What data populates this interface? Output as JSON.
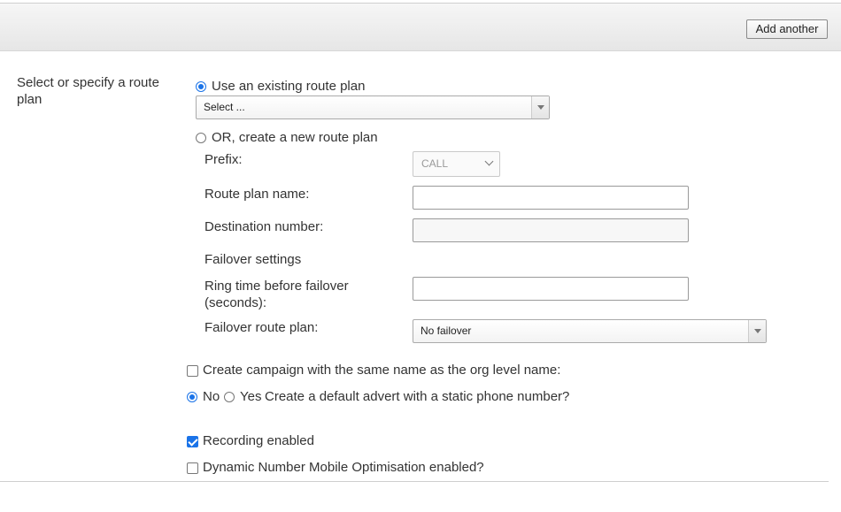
{
  "toolbar": {
    "add_another": "Add another"
  },
  "section": {
    "label": "Select or specify a route plan"
  },
  "existing": {
    "radio_label": "Use an existing route plan",
    "select_value": "Select ..."
  },
  "create": {
    "radio_label": "OR, create a new route plan",
    "prefix_label": "Prefix:",
    "prefix_value": "CALL",
    "route_plan_name_label": "Route plan name:",
    "destination_label": "Destination number:",
    "failover_heading": "Failover settings",
    "ring_time_label": "Ring time before failover (seconds):",
    "failover_plan_label": "Failover route plan:",
    "failover_plan_value": "No failover"
  },
  "options": {
    "campaign_label": "Create campaign with the same name as the org level name:",
    "advert_no": "No",
    "advert_yes": "Yes",
    "advert_question": "Create a default advert with a static phone number?",
    "recording_label": "Recording enabled",
    "dynamic_label": "Dynamic Number Mobile Optimisation enabled?"
  },
  "colors": {
    "accent": "#1a73e8"
  }
}
